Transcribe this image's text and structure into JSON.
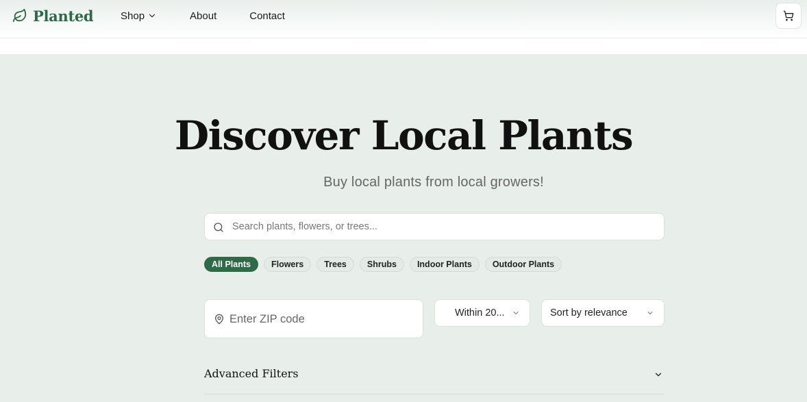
{
  "brand": {
    "name": "Planted",
    "color": "#2f6a46"
  },
  "nav": {
    "shop": "Shop",
    "about": "About",
    "contact": "Contact"
  },
  "cart": {
    "icon": "cart-icon"
  },
  "hero": {
    "title": "Discover Local Plants",
    "subtitle": "Buy local plants from local growers!"
  },
  "search": {
    "placeholder": "Search plants, flowers, or trees...",
    "value": ""
  },
  "categories": [
    {
      "label": "All Plants",
      "active": true
    },
    {
      "label": "Flowers",
      "active": false
    },
    {
      "label": "Trees",
      "active": false
    },
    {
      "label": "Shrubs",
      "active": false
    },
    {
      "label": "Indoor Plants",
      "active": false
    },
    {
      "label": "Outdoor Plants",
      "active": false
    }
  ],
  "location": {
    "placeholder": "Enter ZIP code",
    "value": ""
  },
  "radius": {
    "selected": "Within 20..."
  },
  "sort": {
    "selected": "Sort by relevance"
  },
  "advanced_filters": {
    "label": "Advanced Filters"
  },
  "colors": {
    "accent": "#2f6a46",
    "background": "#e8efea"
  }
}
